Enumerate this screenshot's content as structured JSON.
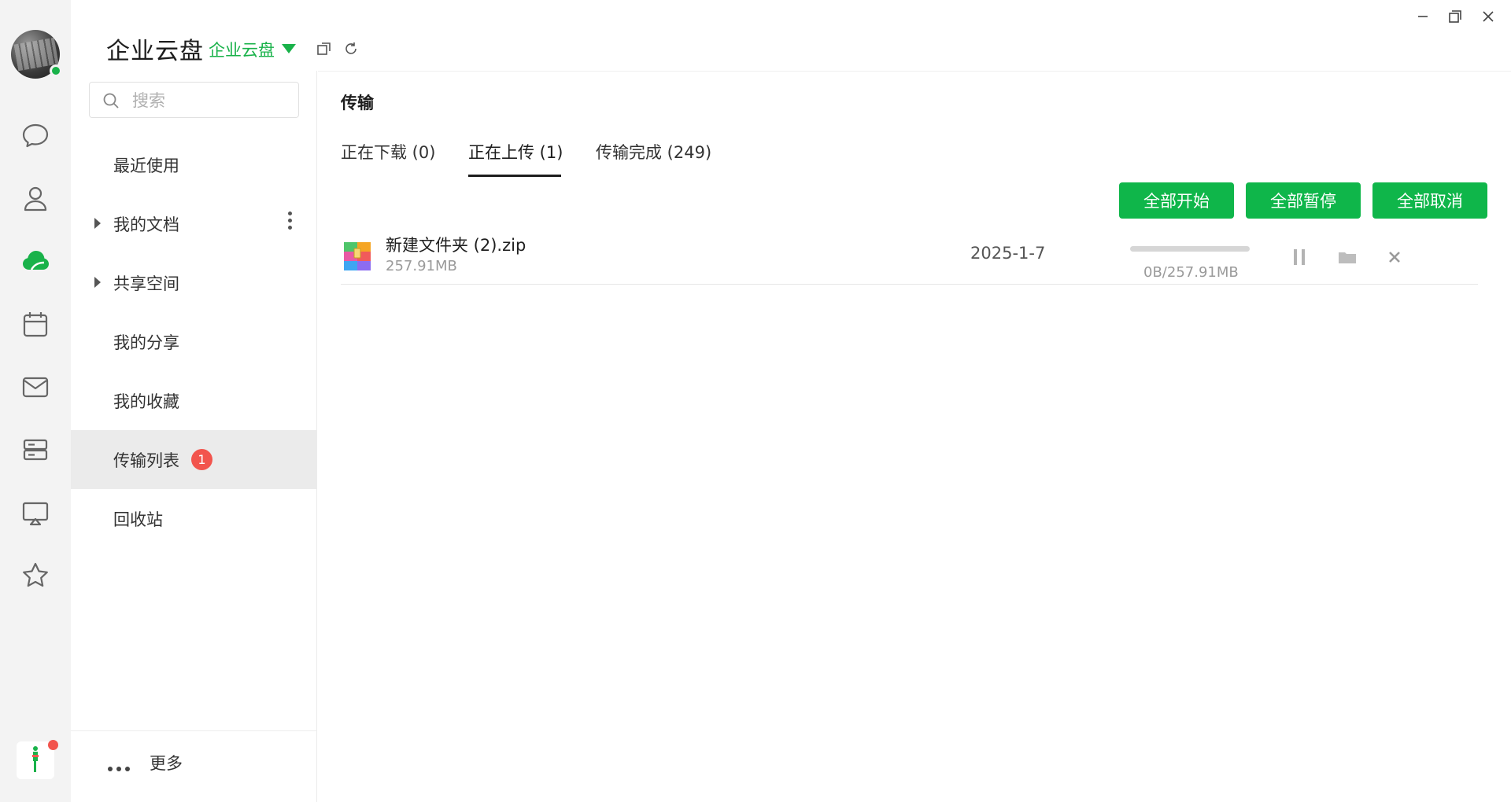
{
  "app": {
    "title": "企业云盘",
    "space_selector": "企业云盘"
  },
  "search": {
    "placeholder": "搜索"
  },
  "sidebar": {
    "items": [
      {
        "label": "最近使用"
      },
      {
        "label": "我的文档"
      },
      {
        "label": "共享空间"
      },
      {
        "label": "我的分享"
      },
      {
        "label": "我的收藏"
      },
      {
        "label": "传输列表",
        "badge": "1"
      },
      {
        "label": "回收站"
      }
    ],
    "more_label": "更多"
  },
  "main": {
    "title": "传输",
    "tabs": [
      {
        "label": "正在下载 (0)"
      },
      {
        "label": "正在上传 (1)",
        "active": true
      },
      {
        "label": "传输完成 (249)"
      }
    ],
    "buttons": {
      "start_all": "全部开始",
      "pause_all": "全部暂停",
      "cancel_all": "全部取消"
    },
    "transfers": [
      {
        "name": "新建文件夹 (2).zip",
        "size": "257.91MB",
        "date": "2025-1-7",
        "progress_text": "0B/257.91MB",
        "progress": 0
      }
    ]
  },
  "colors": {
    "accent": "#19b24a",
    "button": "#0fb64a",
    "badge": "#f2544d"
  }
}
